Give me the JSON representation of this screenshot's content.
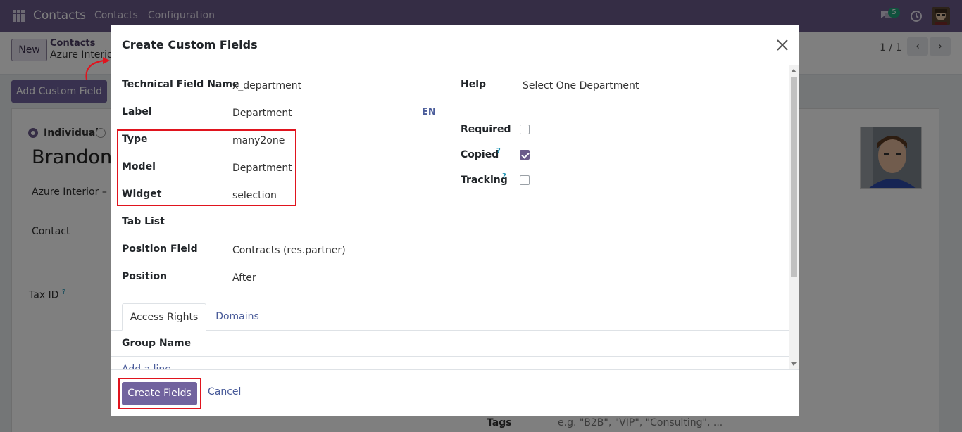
{
  "navbar": {
    "app_title": "Contacts",
    "menu": [
      "Contacts",
      "Configuration"
    ],
    "chat_badge": "5",
    "icons": [
      "apps-grid-icon",
      "chat-icon",
      "clock-icon",
      "user-avatar"
    ]
  },
  "control_panel": {
    "new_label": "New",
    "breadcrumb_parent": "Contacts",
    "breadcrumb_current": "Azure Interior",
    "pager": "1 / 1",
    "prev_icon": "‹",
    "next_icon": "›",
    "add_custom_field_label": "Add Custom Field"
  },
  "form": {
    "individual_label": "Individual",
    "partner_name": "Brandon",
    "company_line": "Azure Interior – U",
    "contact_label": "Contact",
    "tax_id_label": "Tax ID",
    "tax_id_help": "?",
    "tags_label": "Tags",
    "tags_placeholder": "e.g. \"B2B\", \"VIP\", \"Consulting\", ..."
  },
  "modal": {
    "title": "Create Custom Fields",
    "close_icon": "×",
    "fields": {
      "technical_field_name": {
        "label": "Technical Field Name",
        "value": "x_department"
      },
      "label": {
        "label": "Label",
        "value": "Department",
        "lang": "EN"
      },
      "type": {
        "label": "Type",
        "value": "many2one"
      },
      "model": {
        "label": "Model",
        "value": "Department"
      },
      "widget": {
        "label": "Widget",
        "value": "selection"
      },
      "tab_list": {
        "label": "Tab List",
        "value": ""
      },
      "position_field": {
        "label": "Position Field",
        "value": "Contracts (res.partner)"
      },
      "position": {
        "label": "Position",
        "value": "After"
      },
      "help": {
        "label": "Help",
        "value": "Select One Department"
      },
      "required": {
        "label": "Required",
        "checked": false
      },
      "copied": {
        "label": "Copied",
        "help": "?",
        "checked": true
      },
      "tracking": {
        "label": "Tracking",
        "help": "?",
        "checked": false
      }
    },
    "tabs": [
      {
        "label": "Access Rights",
        "active": true
      },
      {
        "label": "Domains",
        "active": false
      }
    ],
    "group_name_header": "Group Name",
    "add_line": "Add a line",
    "footer": {
      "create_label": "Create Fields",
      "cancel_label": "Cancel"
    }
  },
  "colors": {
    "navbar": "#6b5a8a",
    "primary_button": "#71639e",
    "highlight": "#e0141e",
    "link": "#4a5c9a"
  }
}
